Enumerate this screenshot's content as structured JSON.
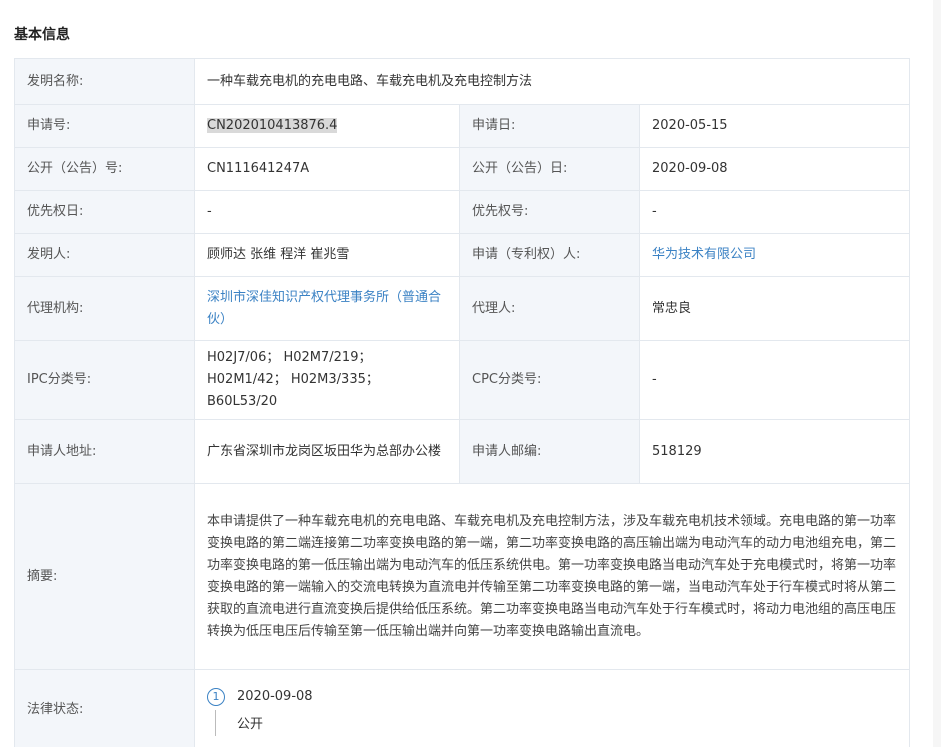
{
  "section_title": "基本信息",
  "rows": {
    "invention_name": {
      "label": "发明名称:",
      "value": "一种车载充电机的充电电路、车载充电机及充电控制方法"
    },
    "application_no": {
      "label": "申请号:",
      "value": "CN202010413876.4"
    },
    "application_date": {
      "label": "申请日:",
      "value": "2020-05-15"
    },
    "publication_no": {
      "label": "公开（公告）号:",
      "value": "CN111641247A"
    },
    "publication_date": {
      "label": "公开（公告）日:",
      "value": "2020-09-08"
    },
    "priority_date": {
      "label": "优先权日:",
      "value": "-"
    },
    "priority_no": {
      "label": "优先权号:",
      "value": "-"
    },
    "inventors": {
      "label": "发明人:",
      "value": "顾师达 张维 程洋 崔兆雪"
    },
    "applicant": {
      "label": "申请（专利权）人:",
      "value": "华为技术有限公司"
    },
    "agency": {
      "label": "代理机构:",
      "value": "深圳市深佳知识产权代理事务所（普通合伙）"
    },
    "agent": {
      "label": "代理人:",
      "value": "常忠良"
    },
    "ipc": {
      "label": "IPC分类号:",
      "value": "H02J7/06； H02M7/219； H02M1/42； H02M3/335； B60L53/20"
    },
    "cpc": {
      "label": "CPC分类号:",
      "value": "-"
    },
    "applicant_address": {
      "label": "申请人地址:",
      "value": "广东省深圳市龙岗区坂田华为总部办公楼"
    },
    "applicant_postcode": {
      "label": "申请人邮编:",
      "value": "518129"
    },
    "abstract": {
      "label": "摘要:",
      "value": "本申请提供了一种车载充电机的充电电路、车载充电机及充电控制方法，涉及车载充电机技术领域。充电电路的第一功率变换电路的第二端连接第二功率变换电路的第一端，第二功率变换电路的高压输出端为电动汽车的动力电池组充电，第二功率变换电路的第一低压输出端为电动汽车的低压系统供电。第一功率变换电路当电动汽车处于充电模式时，将第一功率变换电路的第一端输入的交流电转换为直流电并传输至第二功率变换电路的第一端，当电动汽车处于行车模式时将从第二获取的直流电进行直流变换后提供给低压系统。第二功率变换电路当电动汽车处于行车模式时，将动力电池组的高压电压转换为低压电压后传输至第一低压输出端并向第一功率变换电路输出直流电。"
    },
    "legal_status": {
      "label": "法律状态:",
      "step": "1",
      "date": "2020-09-08",
      "status": "公开"
    }
  }
}
